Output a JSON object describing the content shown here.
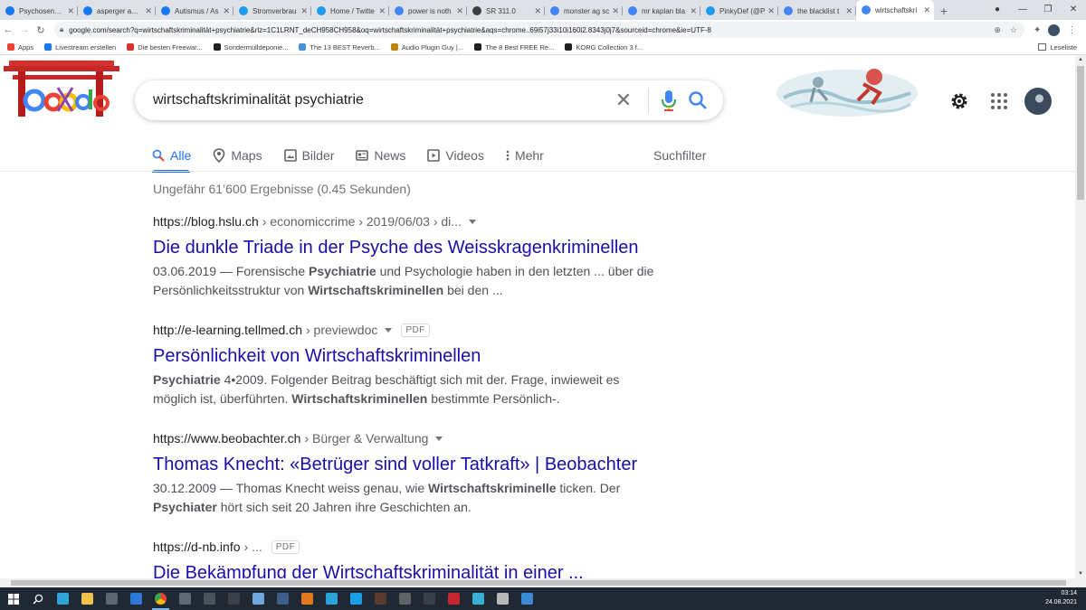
{
  "browser": {
    "tabs": [
      {
        "title": "Psychosen&Ce",
        "favicon_color": "#1877f2",
        "favicon": "facebook-icon"
      },
      {
        "title": "asperger autis",
        "favicon_color": "#1877f2",
        "favicon": "facebook-icon"
      },
      {
        "title": "Autismus / As",
        "favicon_color": "#1877f2",
        "favicon": "facebook-icon"
      },
      {
        "title": "Stromverbrau",
        "favicon_color": "#1d9bf0",
        "favicon": "twitter-icon"
      },
      {
        "title": "Home / Twitte",
        "favicon_color": "#1d9bf0",
        "favicon": "twitter-icon"
      },
      {
        "title": "power is noth",
        "favicon_color": "#4285f4",
        "favicon": "google-icon"
      },
      {
        "title": "SR 311.0",
        "favicon_color": "#3c4043",
        "favicon": "globe-icon"
      },
      {
        "title": "monster ag sc",
        "favicon_color": "#4285f4",
        "favicon": "google-icon"
      },
      {
        "title": "mr kaplan bla",
        "favicon_color": "#4285f4",
        "favicon": "google-icon"
      },
      {
        "title": "PinkyDef (@P",
        "favicon_color": "#1d9bf0",
        "favicon": "twitter-icon"
      },
      {
        "title": "the blacklist t",
        "favicon_color": "#4285f4",
        "favicon": "google-icon"
      },
      {
        "title": "wirtschaftskri",
        "favicon_color": "#4285f4",
        "favicon": "google-icon",
        "active": true
      }
    ],
    "url": "google.com/search?q=wirtschaftskriminalität+psychiatrie&rlz=1C1LRNT_deCH958CH958&oq=wirtschaftskriminalität+psychiatrie&aqs=chrome..69i57j33i10i160l2.8343j0j7&sourceid=chrome&ie=UTF-8",
    "bookmarks": [
      {
        "label": "Apps",
        "color": "#ea4335"
      },
      {
        "label": "Livestream erstellen",
        "color": "#1877f2"
      },
      {
        "label": "Die besten Freewar...",
        "color": "#d93025"
      },
      {
        "label": "Sondermülldeponie...",
        "color": "#202124"
      },
      {
        "label": "The 13 BEST Reverb...",
        "color": "#4a90d9"
      },
      {
        "label": "Audio Plugin Guy |...",
        "color": "#b8860b"
      },
      {
        "label": "The 8 Best FREE Re...",
        "color": "#202124"
      },
      {
        "label": "KORG Collection 3 f...",
        "color": "#202124"
      }
    ],
    "reading_list": "Leseliste"
  },
  "search": {
    "query": "wirtschaftskriminalität psychiatrie"
  },
  "nav_tabs": [
    {
      "label": "Alle",
      "icon": "search-icon",
      "active": true
    },
    {
      "label": "Maps",
      "icon": "map-pin-icon"
    },
    {
      "label": "Bilder",
      "icon": "image-icon"
    },
    {
      "label": "News",
      "icon": "news-icon"
    },
    {
      "label": "Videos",
      "icon": "video-icon"
    },
    {
      "label": "Mehr",
      "icon": "more-vert-icon"
    }
  ],
  "filter_label": "Suchfilter",
  "stats": "Ungefähr 61’600 Ergebnisse (0.45 Sekunden)",
  "results": [
    {
      "site": "https://blog.hslu.ch",
      "path": "› economiccrime › 2019/06/03 › di...",
      "title": "Die dunkle Triade in der Psyche des Weisskragenkriminellen",
      "date": "03.06.2019",
      "snippet_html": "03.06.2019 — Forensische <b>Psychiatrie</b> und Psychologie haben in den letzten ... über die Persönlichkeitsstruktur von <b>Wirtschaftskriminellen</b> bei den ..."
    },
    {
      "site": "http://e-learning.tellmed.ch",
      "path": "› previewdoc",
      "badge": "PDF",
      "title": "Persönlichkeit von Wirtschaftskriminellen",
      "snippet_html": "<b>Psychiatrie</b> 4•2009. Folgender Beitrag beschäftigt sich mit der. Frage, inwieweit es möglich ist, überführten. <b>Wirtschaftskriminellen</b> bestimmte Persönlich-."
    },
    {
      "site": "https://www.beobachter.ch",
      "path": "› Bürger & Verwaltung",
      "title": "Thomas Knecht: «Betrüger sind voller Tatkraft» | Beobachter",
      "snippet_html": "30.12.2009 — Thomas Knecht weiss genau, wie <b>Wirtschaftskriminelle</b> ticken. Der <b>Psychiater</b> hört sich seit 20 Jahren ihre Geschichten an."
    },
    {
      "site": "https://d-nb.info",
      "path": "› ...",
      "badge": "PDF",
      "title": "Die Bekämpfung der Wirtschaftskriminalität in einer ..."
    }
  ],
  "taskbar": {
    "time": "03:14",
    "date": "24.08.2021",
    "apps": [
      {
        "icon": "start-icon",
        "color": "#ffffff"
      },
      {
        "icon": "search-icon",
        "color": "#ffffff"
      },
      {
        "icon": "edge-icon",
        "color": "#2ea4d9"
      },
      {
        "icon": "folder-icon",
        "color": "#f3c24b"
      },
      {
        "icon": "store-icon",
        "color": "#5b6770"
      },
      {
        "icon": "mail-icon",
        "color": "#2a7ad6"
      },
      {
        "icon": "chrome-icon",
        "color": "#e04a3a",
        "active": true
      },
      {
        "icon": "mouse-icon",
        "color": "#606a75"
      },
      {
        "icon": "vlc-icon",
        "color": "#4a525c"
      },
      {
        "icon": "live-icon",
        "color": "#3b414a"
      },
      {
        "icon": "cloud-icon",
        "color": "#6fa8dc"
      },
      {
        "icon": "photos-icon",
        "color": "#3b5f8a"
      },
      {
        "icon": "jdownloader-icon",
        "color": "#e07a1d"
      },
      {
        "icon": "telegram-icon",
        "color": "#2aa3d8"
      },
      {
        "icon": "skype-icon",
        "color": "#1a9ee5"
      },
      {
        "icon": "winamp-icon",
        "color": "#5a3a2c"
      },
      {
        "icon": "keyboard-icon",
        "color": "#5f6368"
      },
      {
        "icon": "tool-icon",
        "color": "#3a4048"
      },
      {
        "icon": "media-icon",
        "color": "#c9252c"
      },
      {
        "icon": "chat-icon",
        "color": "#3ab0d6"
      },
      {
        "icon": "window-icon",
        "color": "#b8b8b8"
      },
      {
        "icon": "app-icon",
        "color": "#3a8ad6"
      }
    ]
  }
}
